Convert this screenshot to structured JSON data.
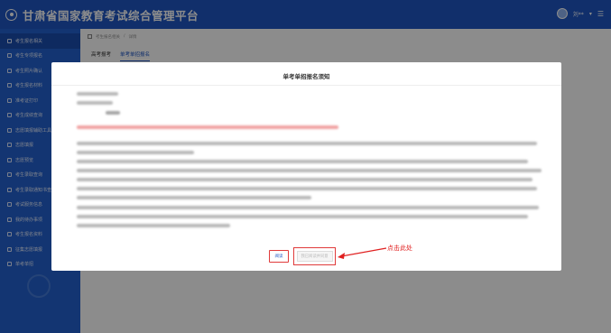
{
  "header": {
    "title": "甘肃省国家教育考试综合管理平台",
    "user_name": "刘**"
  },
  "sidebar": {
    "items": [
      {
        "label": "考生报名相关"
      },
      {
        "label": "考生专项报名"
      },
      {
        "label": "考生照片确认"
      },
      {
        "label": "考生报名材料"
      },
      {
        "label": "准考证打印"
      },
      {
        "label": "考生成绩查询"
      },
      {
        "label": "志愿填报辅助工具"
      },
      {
        "label": "志愿填报"
      },
      {
        "label": "志愿预览"
      },
      {
        "label": "考生录取查询"
      },
      {
        "label": "考生录取通知书查询"
      },
      {
        "label": "考试服务信息"
      },
      {
        "label": "我的待办事项"
      },
      {
        "label": "考生报名资料"
      },
      {
        "label": "征集志愿填报"
      },
      {
        "label": "单考单招"
      }
    ]
  },
  "main": {
    "breadcrumb": [
      "考生报名相关",
      "/",
      "详情"
    ],
    "tabs": [
      {
        "label": "高考报考"
      },
      {
        "label": "单考单招报名"
      }
    ]
  },
  "modal": {
    "title": "单考单招报名须知",
    "read_button": "阅读",
    "agree_button": "我已阅读并同意"
  },
  "annotation": {
    "text": "点击此处",
    "color": "#e02020"
  },
  "colors": {
    "header_bg": "#1f56c4",
    "sidebar_bg": "#2461cf",
    "highlight_red": "#e03a3a"
  }
}
